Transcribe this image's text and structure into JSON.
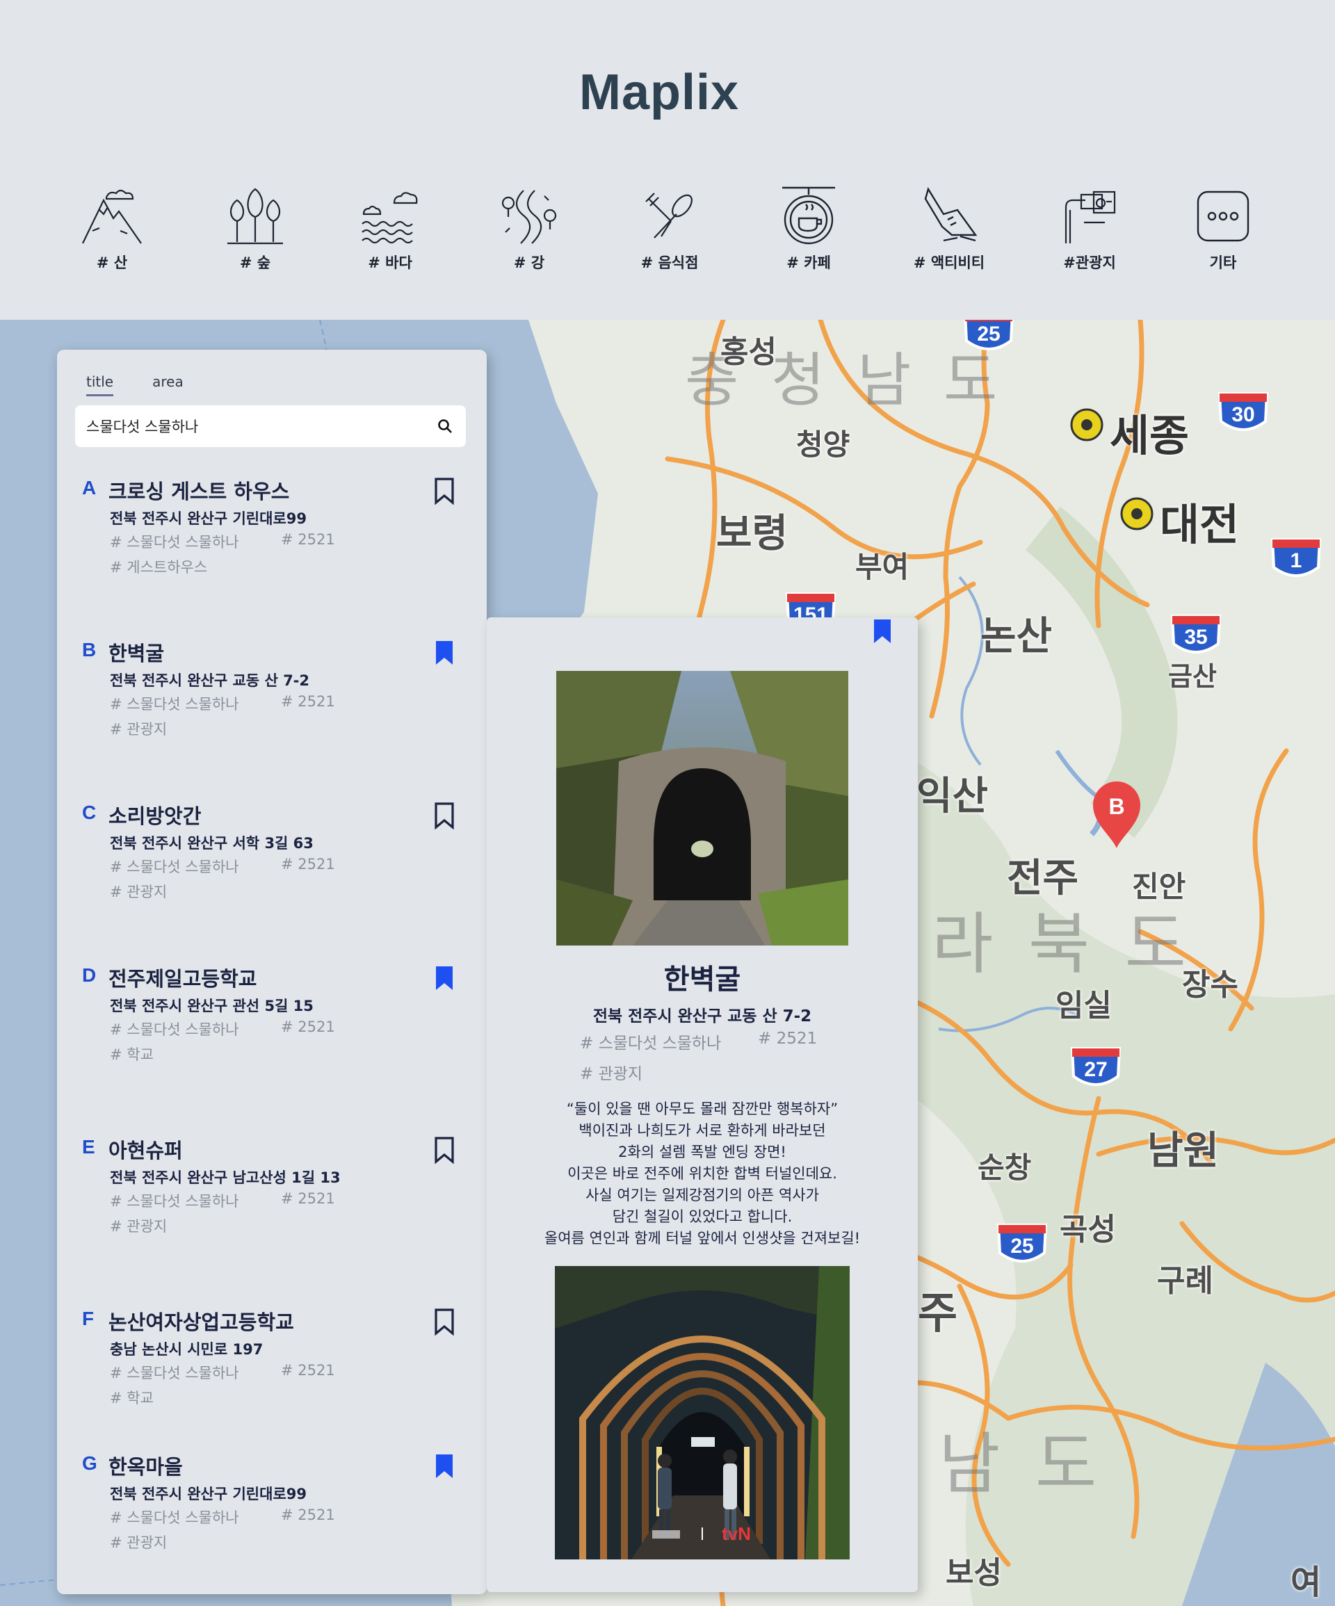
{
  "app": {
    "title": "Maplix"
  },
  "categories": [
    {
      "label": "# 산",
      "icon": "mountain-icon"
    },
    {
      "label": "# 숲",
      "icon": "forest-icon"
    },
    {
      "label": "# 바다",
      "icon": "sea-icon"
    },
    {
      "label": "# 강",
      "icon": "river-icon"
    },
    {
      "label": "# 음식점",
      "icon": "restaurant-icon"
    },
    {
      "label": "# 카페",
      "icon": "cafe-icon"
    },
    {
      "label": "# 액티비티",
      "icon": "activity-icon"
    },
    {
      "label": "#관광지",
      "icon": "tourist-spot-icon"
    },
    {
      "label": "기타",
      "icon": "more-icon"
    }
  ],
  "search": {
    "tabs": [
      {
        "label": "title",
        "active": true
      },
      {
        "label": "area",
        "active": false
      }
    ],
    "value": "스물다섯 스물하나",
    "icon": "search-icon"
  },
  "results": [
    {
      "letter": "A",
      "name": "크로싱 게스트 하우스",
      "address": "전북 전주시 완산구 기린대로99",
      "tags": [
        "# 스물다섯 스물하나",
        "# 2521",
        "# 게스트하우스"
      ],
      "bookmarked": false
    },
    {
      "letter": "B",
      "name": "한벽굴",
      "address": "전북 전주시 완산구 교동 산 7-2",
      "tags": [
        "# 스물다섯 스물하나",
        "# 2521",
        "# 관광지"
      ],
      "bookmarked": true
    },
    {
      "letter": "C",
      "name": "소리방앗간",
      "address": "전북 전주시 완산구 서학 3길 63",
      "tags": [
        "# 스물다섯 스물하나",
        "# 2521",
        "# 관광지"
      ],
      "bookmarked": false
    },
    {
      "letter": "D",
      "name": "전주제일고등학교",
      "address": "전북 전주시 완산구 관선 5길 15",
      "tags": [
        "# 스물다섯 스물하나",
        "# 2521",
        "# 학교"
      ],
      "bookmarked": true
    },
    {
      "letter": "E",
      "name": "아현슈퍼",
      "address": "전북 전주시 완산구 남고산성 1길 13",
      "tags": [
        "# 스물다섯 스물하나",
        "# 2521",
        "# 관광지"
      ],
      "bookmarked": false
    },
    {
      "letter": "F",
      "name": "논산여자상업고등학교",
      "address": "충남 논산시 시민로 197",
      "tags": [
        "# 스물다섯 스물하나",
        "# 2521",
        "# 학교"
      ],
      "bookmarked": false
    },
    {
      "letter": "G",
      "name": "한옥마을",
      "address": "전북 전주시 완산구 기린대로99",
      "tags": [
        "# 스물다섯 스물하나",
        "# 2521",
        "# 관광지"
      ],
      "bookmarked": true
    }
  ],
  "detail": {
    "title": "한벽굴",
    "address": "전북 전주시 완산구 교동 산 7-2",
    "tags": [
      "# 스물다섯 스물하나",
      "# 2521",
      "# 관광지"
    ],
    "bookmarked": true,
    "description": [
      "“둘이 있을 땐 아무도 몰래 잠깐만 행복하자”",
      "백이진과 나희도가 서로 환하게 바라보던",
      "2화의 설렘 폭발 엔딩 장면!",
      "이곳은 바로 전주에 위치한 합벽 터널인데요.",
      "사실 여기는 일제강점기의 아픈 역사가",
      "담긴 철길이 있었다고 합니다.",
      "올여름 연인과 함께 터널 앞에서 인생샷을 건져보길!"
    ],
    "photo_logo": "tvN"
  },
  "map": {
    "selected_marker": "B",
    "places": [
      "홍성",
      "충 청 남 도",
      "청양",
      "세종",
      "대전",
      "보령",
      "부여",
      "논산",
      "금산",
      "익산",
      "전주",
      "진안",
      "라 북 도",
      "장수",
      "임실",
      "남원",
      "순창",
      "곡성",
      "구례",
      "주",
      "남 도",
      "보성",
      "여"
    ],
    "routes": [
      "25",
      "30",
      "1",
      "151",
      "35",
      "27",
      "25"
    ],
    "colors": {
      "road": "#f1a24a",
      "water": "#a7bed6",
      "land": "#e8ebe4",
      "marker": "#e84545",
      "bookmark": "#1e4ff0"
    }
  }
}
